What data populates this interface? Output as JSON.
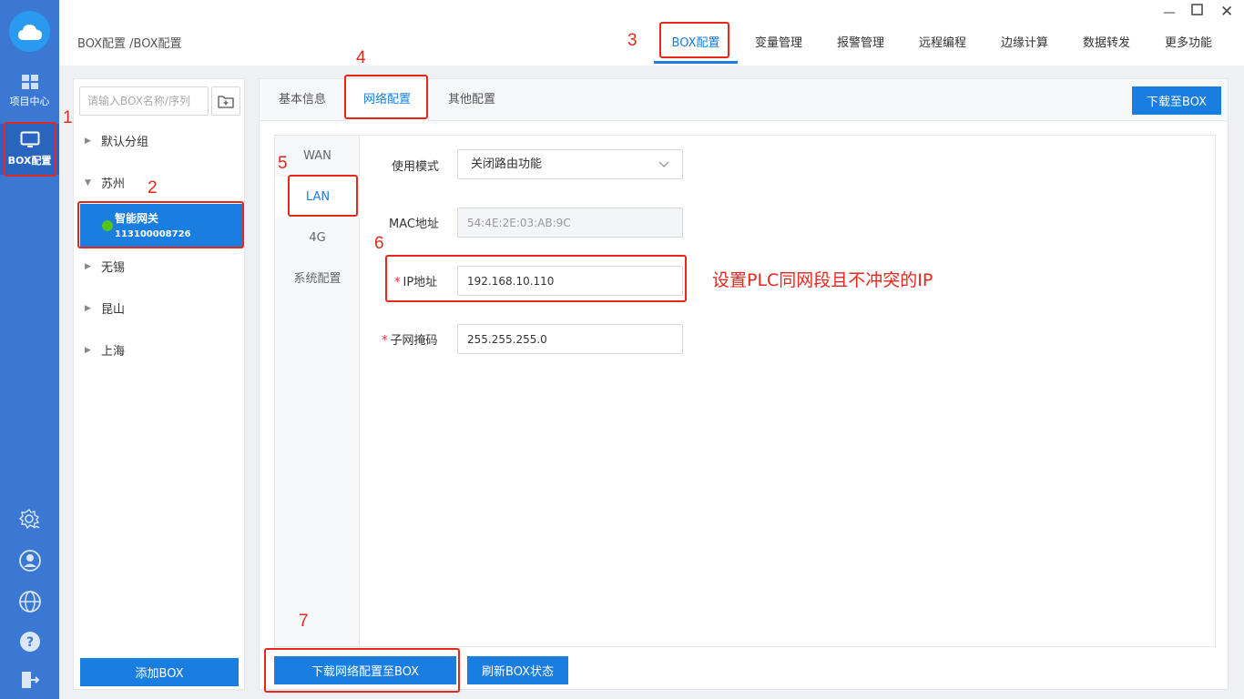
{
  "rail": {
    "items": [
      {
        "label": "项目中心",
        "icon": "grid-icon"
      },
      {
        "label": "BOX配置",
        "icon": "monitor-icon"
      }
    ],
    "bottom_icons": [
      "settings-icon",
      "user-icon",
      "globe-icon",
      "help-icon",
      "logout-icon"
    ]
  },
  "header": {
    "breadcrumb": "BOX配置 /BOX配置",
    "tabs": [
      {
        "label": "BOX配置",
        "active": true
      },
      {
        "label": "变量管理"
      },
      {
        "label": "报警管理"
      },
      {
        "label": "远程编程"
      },
      {
        "label": "边缘计算"
      },
      {
        "label": "数据转发"
      },
      {
        "label": "更多功能"
      }
    ]
  },
  "devices": {
    "search_placeholder": "请输入BOX名称/序列",
    "groups": [
      {
        "label": "默认分组"
      },
      {
        "label": "苏州"
      },
      {
        "label": "无锡"
      },
      {
        "label": "昆山"
      },
      {
        "label": "上海"
      }
    ],
    "selected": {
      "name": "智能网关",
      "serial": "113100008726"
    },
    "add_label": "添加BOX"
  },
  "main": {
    "tabs": [
      "基本信息",
      "网络配置",
      "其他配置"
    ],
    "download_label": "下载至BOX",
    "side_tabs": [
      "WAN",
      "LAN",
      "4G",
      "系统配置"
    ],
    "form": {
      "mode_label": "使用模式",
      "mode_value": "关闭路由功能",
      "mac_label": "MAC地址",
      "mac_value": "54:4E:2E:03:AB:9C",
      "ip_label": "IP地址",
      "ip_value": "192.168.10.110",
      "mask_label": "子网掩码",
      "mask_value": "255.255.255.0"
    },
    "note": "设置PLC同网段且不冲突的IP",
    "footer": {
      "download_net_label": "下载网络配置至BOX",
      "refresh_label": "刷新BOX状态"
    }
  },
  "annotations": [
    "1",
    "2",
    "3",
    "4",
    "5",
    "6",
    "7"
  ],
  "colors": {
    "accent": "#1a7ee0",
    "rail": "#3a78d4",
    "annotation": "#e8271b",
    "online": "#52c41a"
  }
}
